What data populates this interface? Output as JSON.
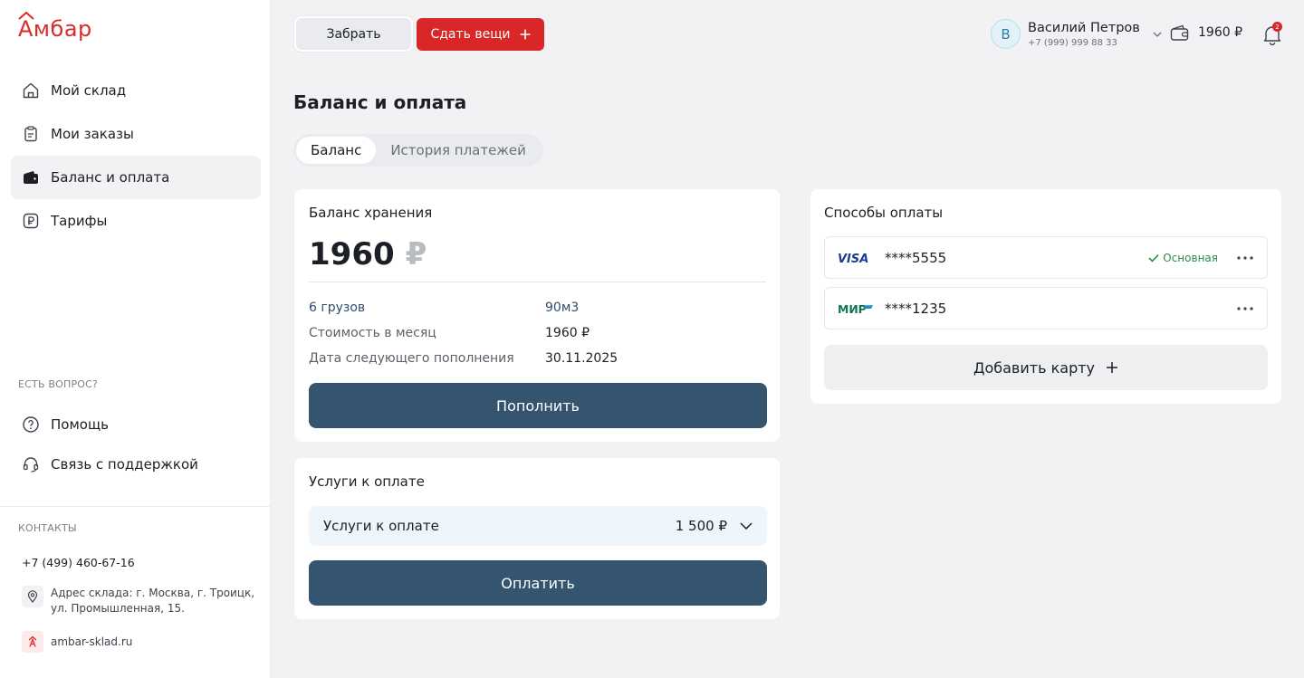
{
  "brand": {
    "logo_text": "Амбар",
    "accent": "#d92626"
  },
  "sidebar": {
    "nav": [
      {
        "label": "Мой склад",
        "icon": "home-icon"
      },
      {
        "label": "Мои заказы",
        "icon": "clipboard-icon"
      },
      {
        "label": "Баланс и оплата",
        "icon": "wallet-icon",
        "active": true
      },
      {
        "label": "Тарифы",
        "icon": "ruble-icon"
      }
    ],
    "help_label": "ЕСТЬ ВОПРОС?",
    "help": [
      {
        "label": "Помощь",
        "icon": "question-icon"
      },
      {
        "label": "Связь с поддержкой",
        "icon": "headset-icon"
      }
    ],
    "contacts_label": "КОНТАКТЫ",
    "phone": "+7 (499) 460-67-16",
    "address_line1": "Адрес склада: г. Москва,  г. Троицк,",
    "address_line2": "ул. Промышленная, 15.",
    "site": "ambar-sklad.ru"
  },
  "topbar": {
    "take_label": "Забрать",
    "give_label": "Сдать вещи",
    "user": {
      "initial": "В",
      "name": "Василий Петров",
      "phone": "+7 (999) 999 88 33"
    },
    "wallet_balance": "1960 ₽",
    "notifications_count": "2"
  },
  "page": {
    "title": "Баланс и оплата",
    "tabs": [
      {
        "label": "Баланс",
        "active": true
      },
      {
        "label": "История платежей",
        "active": false
      }
    ]
  },
  "balance_card": {
    "title": "Баланс хранения",
    "amount": "1960",
    "currency": "₽",
    "rows": [
      {
        "key": "6 грузов",
        "value": "90м3"
      },
      {
        "key": "Стоимость в месяц",
        "value": "1960 ₽"
      },
      {
        "key": "Дата следующего пополнения",
        "value": "30.11.2025"
      }
    ],
    "topup_label": "Пополнить"
  },
  "services_card": {
    "title": "Услуги к оплате",
    "row_label": "Услуги к оплате",
    "row_amount": "1 500 ₽",
    "pay_label": "Оплатить"
  },
  "payment_methods": {
    "title": "Способы оплаты",
    "cards": [
      {
        "brand": "VISA",
        "number": "****5555",
        "badge": "Основная"
      },
      {
        "brand": "МИР",
        "number": "****1235"
      }
    ],
    "add_label": "Добавить карту"
  }
}
